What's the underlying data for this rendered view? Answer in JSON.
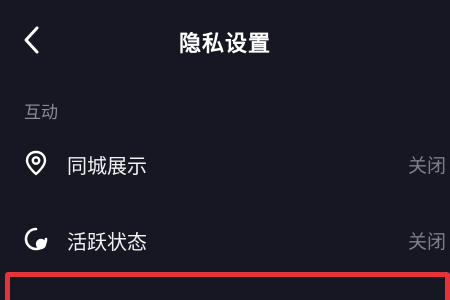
{
  "header": {
    "title": "隐私设置",
    "back_icon": "chevron-left-icon"
  },
  "section": {
    "label": "互动"
  },
  "rows": [
    {
      "label": "同城展示",
      "value": "关闭",
      "icon": "location-pin-icon"
    },
    {
      "label": "活跃状态",
      "value": "关闭",
      "icon": "active-status-icon"
    }
  ],
  "colors": {
    "background": "#161722",
    "highlight": "#e2343a",
    "muted_text": "#7e7f87"
  }
}
